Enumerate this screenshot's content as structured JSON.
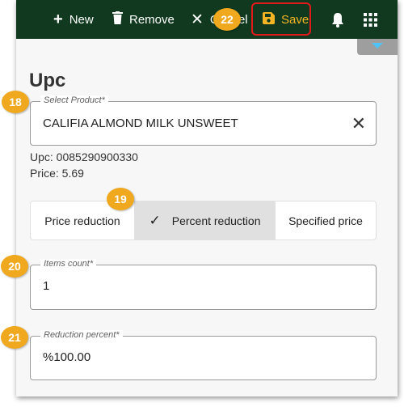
{
  "toolbar": {
    "new_label": "New",
    "remove_label": "Remove",
    "cancel_label": "Cancel",
    "save_label": "Save"
  },
  "page": {
    "title": "Upc"
  },
  "product_field": {
    "label": "Select Product*",
    "value": "CALIFIA ALMOND MILK UNSWEET",
    "clear_icon": "close-icon"
  },
  "product_info": {
    "upc": "Upc: 0085290900330",
    "price": "Price: 5.69"
  },
  "reduction_type": {
    "options": [
      "Price reduction",
      "Percent reduction",
      "Specified price"
    ],
    "selected": "Percent reduction"
  },
  "items_count_field": {
    "label": "Items count*",
    "value": "1"
  },
  "reduction_percent_field": {
    "label": "Reduction percent*",
    "value": "%100.00"
  },
  "markers": [
    "18",
    "19",
    "20",
    "21",
    "22"
  ],
  "colors": {
    "toolbar": "#10391f",
    "save_accent": "#f4b524",
    "highlight_border": "#e11b1b",
    "marker": "#f0a91e"
  }
}
